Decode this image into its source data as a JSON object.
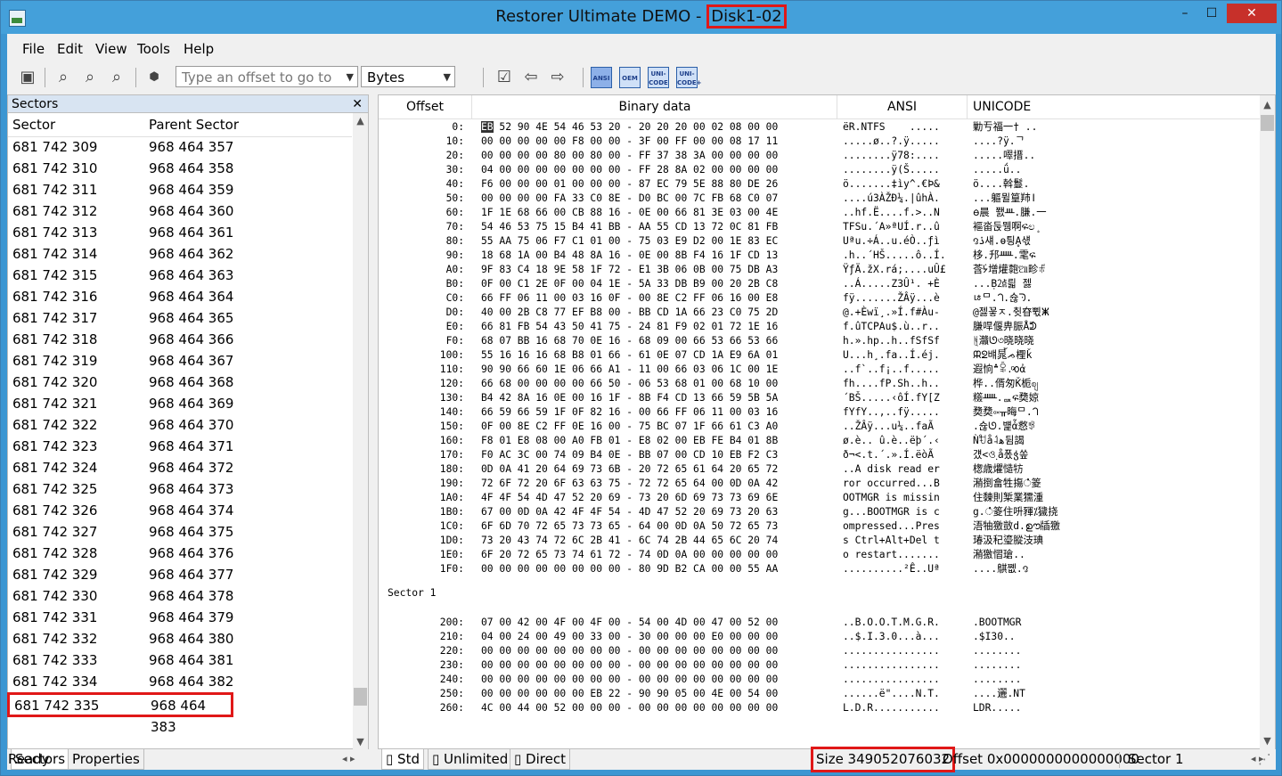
{
  "window": {
    "title_prefix": "Restorer Ultimate DEMO - ",
    "title_highlight": "Disk1-02",
    "controls": {
      "minimize": "–",
      "maximize": "☐",
      "close": "✕"
    }
  },
  "menu": [
    "File",
    "Edit",
    "View",
    "Tools",
    "Help"
  ],
  "toolbar": {
    "offset_placeholder": "Type an offset to go to",
    "units_value": "Bytes",
    "encodings": [
      "ANSI",
      "OEM",
      "UNI-CODE",
      "UNI-CODE+"
    ]
  },
  "sectors_pane": {
    "title": "Sectors",
    "columns": [
      "Sector",
      "Parent Sector"
    ],
    "rows": [
      [
        "681 742 309",
        "968 464 357"
      ],
      [
        "681 742 310",
        "968 464 358"
      ],
      [
        "681 742 311",
        "968 464 359"
      ],
      [
        "681 742 312",
        "968 464 360"
      ],
      [
        "681 742 313",
        "968 464 361"
      ],
      [
        "681 742 314",
        "968 464 362"
      ],
      [
        "681 742 315",
        "968 464 363"
      ],
      [
        "681 742 316",
        "968 464 364"
      ],
      [
        "681 742 317",
        "968 464 365"
      ],
      [
        "681 742 318",
        "968 464 366"
      ],
      [
        "681 742 319",
        "968 464 367"
      ],
      [
        "681 742 320",
        "968 464 368"
      ],
      [
        "681 742 321",
        "968 464 369"
      ],
      [
        "681 742 322",
        "968 464 370"
      ],
      [
        "681 742 323",
        "968 464 371"
      ],
      [
        "681 742 324",
        "968 464 372"
      ],
      [
        "681 742 325",
        "968 464 373"
      ],
      [
        "681 742 326",
        "968 464 374"
      ],
      [
        "681 742 327",
        "968 464 375"
      ],
      [
        "681 742 328",
        "968 464 376"
      ],
      [
        "681 742 329",
        "968 464 377"
      ],
      [
        "681 742 330",
        "968 464 378"
      ],
      [
        "681 742 331",
        "968 464 379"
      ],
      [
        "681 742 332",
        "968 464 380"
      ],
      [
        "681 742 333",
        "968 464 381"
      ],
      [
        "681 742 334",
        "968 464 382"
      ],
      [
        "681 742 335",
        "968 464 383"
      ]
    ],
    "selected_row": 26,
    "tabs": [
      "Sectors",
      "Properties"
    ]
  },
  "hex_view": {
    "columns": [
      "Offset",
      "Binary data",
      "ANSI",
      "UNICODE"
    ],
    "sector0": [
      [
        "0:",
        "EB 52 90 4E 54 46 53 20 - 20 20 20 00 02 08 00 00",
        "ëR.NTFS    .....",
        "勦亐福一† .."
      ],
      [
        "10:",
        "00 00 00 00 00 F8 00 00 - 3F 00 FF 00 00 08 17 11",
        ".....ø..?.ÿ.....",
        "....?ÿ.ᄀ"
      ],
      [
        "20:",
        "00 00 00 00 80 00 80 00 - FF 37 38 3A 00 00 00 00",
        "........ÿ78:....",
        ".....噿搢.."
      ],
      [
        "30:",
        "04 00 00 00 00 00 00 00 - FF 28 8A 02 00 00 00 00",
        "........ÿ(Š.....",
        ".....ǘ.."
      ],
      [
        "40:",
        "F6 00 00 00 01 00 00 00 - 87 EC 79 5E 88 80 DE 26",
        "ö.......‡ìy^.€Þ&",
        "ö....斡鬘."
      ],
      [
        "50:",
        "00 00 00 00 FA 33 C0 8E - D0 BC 00 7C FB 68 C0 07",
        "....ú3ÀŽÐ¼.|ûhÀ.",
        "...軀뮐篁䍨ǀ"
      ],
      [
        "60:",
        "1F 1E 68 66 00 CB 88 16 - 0E 00 66 81 3E 03 00 4E",
        "..hf.Ë....f.>..N",
        "ᰟ晨 쬀ᚈ.膁.一"
      ],
      [
        "70:",
        "54 46 53 75 15 B4 41 BB - AA 55 CD 13 72 0C 81 FB",
        "TFSu.´A»ªUÍ.r..û",
        "䙔畓둕뮁啊ፍಲ﮻"
      ],
      [
        "80:",
        "55 AA 75 06 F7 C1 01 00 - 75 03 E9 D2 00 1E 83 EC",
        "Uªu.÷Á..u.éÒ..ƒì",
        "꩕ۮ섀.ɵ틩Ḁ섃"
      ],
      [
        "90:",
        "18 68 1A 00 B4 48 8A 16 - 0E 00 8B F4 16 1F CD 13",
        ".h..´HŠ.....ô..Í.",
        "栘.䢴ᚊ.雮἖ፍ"
      ],
      [
        "A0:",
        "9F 83 C4 18 9E 58 1F 72 - E1 3B 06 0B 00 75 DB A3",
        "ŸƒÄ.žX.rá;....uÛ£",
        "莟ᣄ增爟㯡ଆ畛ꎛ"
      ],
      [
        "B0:",
        "0F 00 C1 2E 0F 00 04 1E - 5A 33 DB B9 00 20 2B C8",
        "..Á.....Z3Û¹. +È",
        "...Ḅ㍚릛 젫"
      ],
      [
        "C0:",
        "66 FF 06 11 00 03 16 0F - 00 8E C2 FF 06 16 00 E8",
        "fÿ.......ŽÂÿ...è",
        "ﾦᄆ.ᘃ.슎ᘆ."
      ],
      [
        "D0:",
        "40 00 2B C8 77 EF B8 00 - BB CD 1A 66 23 C0 75 2D",
        "@.+Èwï¸.»Í.f#Àu-",
        "@젫꾷ﾸ.췻昚쀣ⵥ"
      ],
      [
        "E0:",
        "66 81 FB 54 43 50 41 75 - 24 81 F9 02 01 72 1E 16",
        "f.ûTCPAu$.ù..r..",
        "膁哻偃畁脤Ǻᕲ"
      ],
      [
        "F0:",
        "68 07 BB 16 68 70 0E 16 - 68 09 00 66 53 66 53 66",
        "h.».hp..h..fSfSf",
        "݈ᚻ灨ᘎ৩晓晓晓"
      ],
      [
        "100:",
        "55 16 16 16 68 B8 01 66 - 61 0E 07 CD 1A E9 6A 01",
        "U...h¸.fa..Í.éj.",
        "ᙕᘖ뱨晁้ᨍ檉ǩ"
      ],
      [
        "110:",
        "90 90 66 60 1E 06 66 A1 - 11 00 66 03 06 1C 00 1E",
        "..f`..f¡..f.....",
        "遐恦؞ꅦ.ͦᰆἀ"
      ],
      [
        "120:",
        "66 68 00 00 00 00 66 50 - 06 53 68 01 00 68 10 00",
        "fh....fP.Sh..h..",
        "桦..偦匆Ǩ栀ဈ"
      ],
      [
        "130:",
        "B4 42 8A 16 0E 00 16 1F - 8B F4 CD 13 66 59 5B 5A",
        "´BŠ.....‹ôÍ.fY[Z",
        "䊴ᚊ.἖ퟢፍ奦婛"
      ],
      [
        "140:",
        "66 59 66 59 1F 0F 82 16 - 00 66 FF 06 11 00 03 16",
        "fYfY..‚..fÿ.....",
        "奦奦༟ᚂ晦ᄆ.ᘃ"
      ],
      [
        "150:",
        "0F 00 8E C2 FF 0E 16 00 - 75 BC 07 1F 66 61 C3 A0",
        "..ŽÂÿ...u¼..faÃ ",
        ".슎ᘎ.뱵ἇ慦ꃃ"
      ],
      [
        "160:",
        "F8 01 E8 08 00 A0 FB 01 - E8 02 00 EB FE B4 01 8B",
        "ø.è.. û.è..ëþ´.‹",
        "Ǹࣨꀀǻ˨ﻫ뒴謁"
      ],
      [
        "170:",
        "F0 AC 3C 00 74 09 B4 0E - BB 07 00 CD 10 EB F2 C3",
        "ð¬<.t.´.».Í.ëòÃ",
        "걨<ও຺ǻ퐀ჭ쏲"
      ],
      [
        "180:",
        "0D 0A 41 20 64 69 73 6B - 20 72 65 61 64 20 65 72",
        "..A disk read er",
        "਍⁁楤歳爠慥⁤牥"
      ],
      [
        "190:",
        "72 6F 72 20 6F 63 63 75 - 72 72 65 64 00 0D 0A 42",
        "ror occurred...B",
        "潲⁲捯畣牲摥ഀ䈊"
      ],
      [
        "1A0:",
        "4F 4F 54 4D 47 52 20 69 - 73 20 6D 69 73 73 69 6E",
        "OOTMGR is missin",
        "住䵔則椠⁳業獳湩"
      ],
      [
        "1B0:",
        "67 00 0D 0A 42 4F 4F 54 - 4D 47 52 20 69 73 20 63",
        "g...BOOTMGR is c",
        "g.ഀ䈊住呏䝍⁒獩挠"
      ],
      [
        "1C0:",
        "6F 6D 70 72 65 73 73 65 - 64 00 0D 0A 50 72 65 73",
        "ompressed...Pres",
        "浯牰獥敳d.ഊ牐獥"
      ],
      [
        "1D0:",
        "73 20 43 74 72 6C 2B 41 - 6C 74 2B 44 65 6C 20 74",
        "s Ctrl+Alt+Del t",
        "⁳瑃汲䄫瑬䐫汥琠"
      ],
      [
        "1E0:",
        "6F 20 72 65 73 74 61 72 - 74 0D 0A 00 00 00 00 00",
        "o restart.......",
        "潲獥慴瑲.."
      ],
      [
        "1F0:",
        "00 00 00 00 00 00 00 00 - 80 9D B2 CA 00 00 55 AA",
        "..........²Ê..Uª",
        "....鶀쪲.꩕"
      ]
    ],
    "sector1_label": "Sector 1",
    "sector1": [
      [
        "200:",
        "07 00 42 00 4F 00 4F 00 - 54 00 4D 00 47 00 52 00",
        "..B.O.O.T.M.G.R.",
        ".BOOTMGR"
      ],
      [
        "210:",
        "04 00 24 00 49 00 33 00 - 30 00 00 00 E0 00 00 00",
        "..$.I.3.0...à...",
        ".$I30.."
      ],
      [
        "220:",
        "00 00 00 00 00 00 00 00 - 00 00 00 00 00 00 00 00",
        "................",
        "........"
      ],
      [
        "230:",
        "00 00 00 00 00 00 00 00 - 00 00 00 00 00 00 00 00",
        "................",
        "........"
      ],
      [
        "240:",
        "00 00 00 00 00 00 00 00 - 00 00 00 00 00 00 00 00",
        "................",
        "........"
      ],
      [
        "250:",
        "00 00 00 00 00 00 EB 22 - 90 90 05 00 4E 00 54 00",
        "......ë\"....N.T.",
        "....邐.NT"
      ],
      [
        "260:",
        "4C 00 44 00 52 00 00 00 - 00 00 00 00 00 00 00 00",
        "L.D.R...........",
        "LDR....."
      ]
    ],
    "tabs": [
      "Std",
      "Unlimited",
      "Direct"
    ]
  },
  "status": {
    "ready": "Ready",
    "size": "Size 349052076032",
    "offset": "Offset 0x0000000000000000",
    "sector": "Sector 1"
  },
  "colors": {
    "title_bar": "#44a0da",
    "highlight_box": "#e01818",
    "close_button": "#c7302a"
  }
}
